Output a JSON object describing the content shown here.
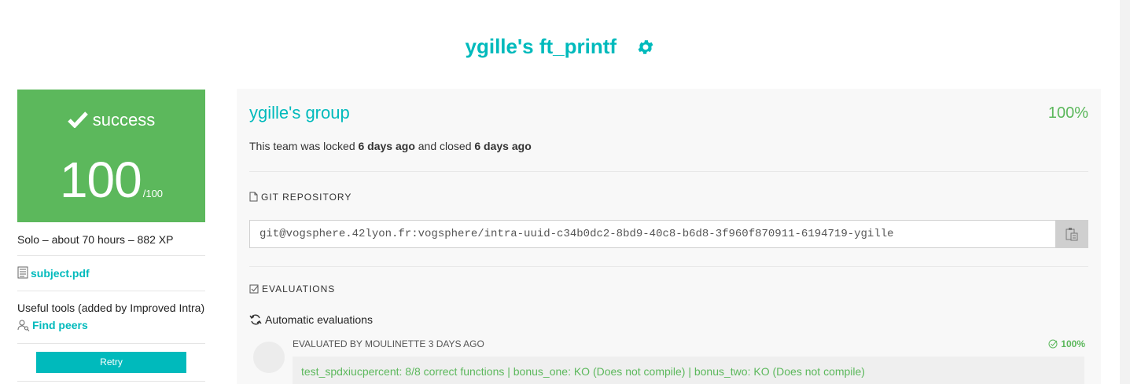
{
  "page": {
    "title": "ygille's ft_printf",
    "settings_icon": "gear-icon",
    "accent_color": "#00babc",
    "success_color": "#5cb85c"
  },
  "sidebar": {
    "status_icon": "checkmark-icon",
    "status": "success",
    "score": "100",
    "score_max": "/100",
    "meta": "Solo – about 70 hours – 882 XP",
    "subject_icon": "document-icon",
    "subject_link": "subject.pdf",
    "tools_label": "Useful tools (added by Improved Intra)",
    "find_peers_icon": "user-search-icon",
    "find_peers": "Find peers",
    "retry_label": "Retry"
  },
  "team": {
    "name": "ygille's group",
    "percent": "100%",
    "lock_prefix": "This team was locked ",
    "locked_ago": "6 days ago",
    "lock_mid": " and closed ",
    "closed_ago": "6 days ago"
  },
  "git": {
    "section_icon": "file-icon",
    "label": "GIT REPOSITORY",
    "url": "git@vogsphere.42lyon.fr:vogsphere/intra-uuid-c34b0dc2-8bd9-40c8-b6d8-3f960f870911-6194719-ygille",
    "copy_icon": "clipboard-icon"
  },
  "evaluations": {
    "section_icon": "checkbox-icon",
    "label": "EVALUATIONS",
    "auto_icon": "refresh-icon",
    "auto_label": "Automatic evaluations",
    "evaluated_by": "EVALUATED BY MOULINETTE 3 DAYS AGO",
    "result_icon": "check-circle-icon",
    "result_percent": "100%",
    "result_text": "test_spdxiucpercent: 8/8 correct functions | bonus_one: KO (Does not compile) | bonus_two: KO (Does not compile)"
  }
}
